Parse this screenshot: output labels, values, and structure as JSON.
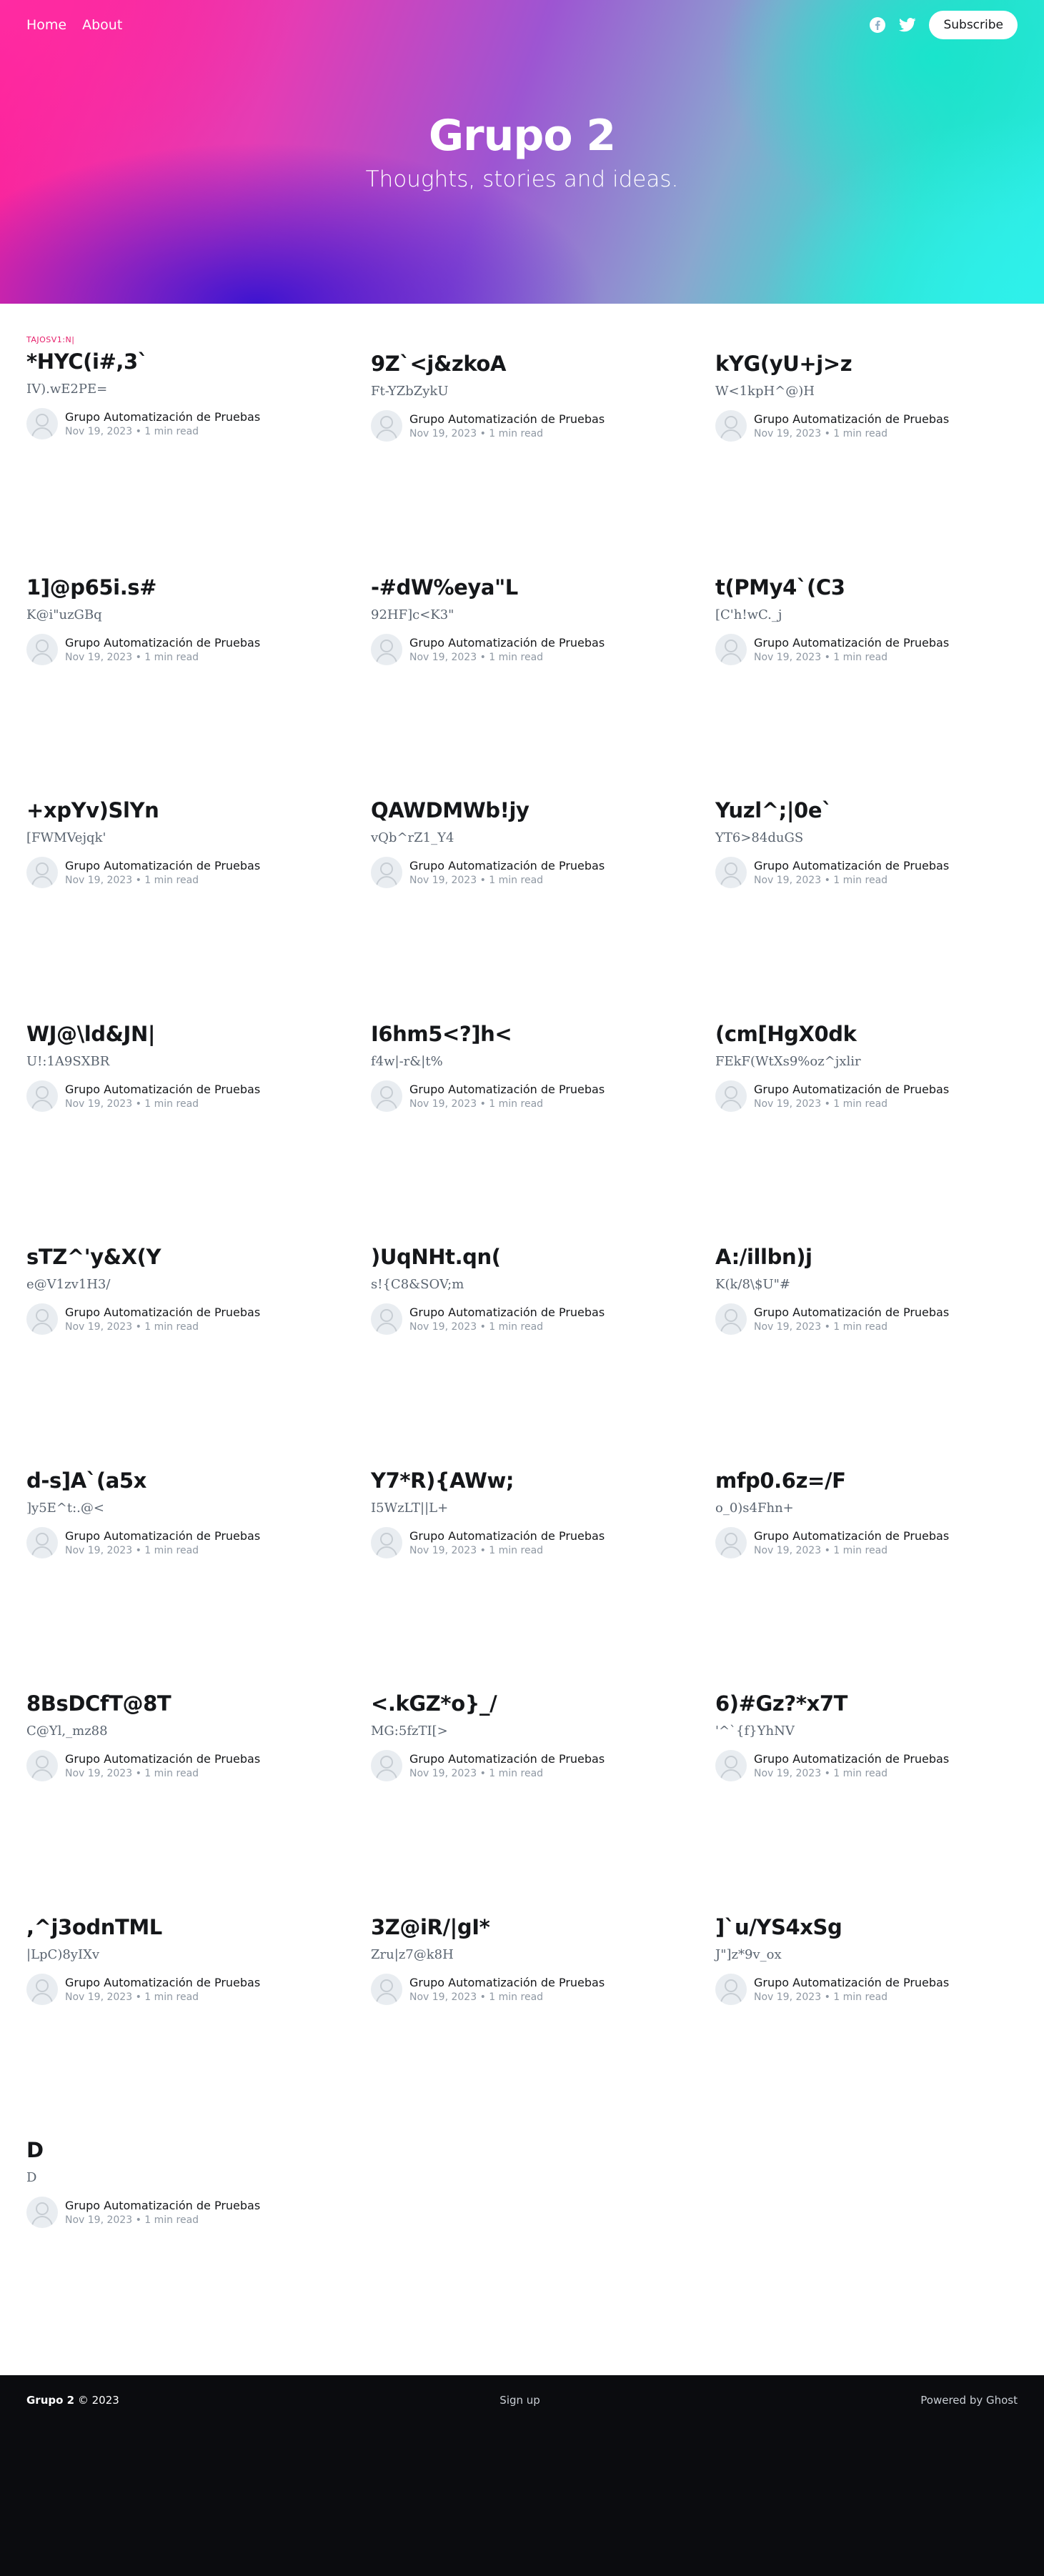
{
  "nav": {
    "home": "Home",
    "about": "About",
    "subscribe": "Subscribe"
  },
  "hero": {
    "title": "Grupo 2",
    "description": "Thoughts, stories and ideas."
  },
  "posts": [
    {
      "tag": "TAJOSV1:N|",
      "title": "*HYC(i#,3`",
      "excerpt": "IV).wE2PE=",
      "author": "Grupo Automatización de Pruebas",
      "date": "Nov 19, 2023",
      "read": "1 min read"
    },
    {
      "tag": "",
      "title": "9Z`<j&zkoA",
      "excerpt": "Ft-YZbZykU",
      "author": "Grupo Automatización de Pruebas",
      "date": "Nov 19, 2023",
      "read": "1 min read"
    },
    {
      "tag": "",
      "title": "kYG(yU+j>z",
      "excerpt": "W<1kpH^@)H",
      "author": "Grupo Automatización de Pruebas",
      "date": "Nov 19, 2023",
      "read": "1 min read"
    },
    {
      "tag": "",
      "title": "1]@p65i.s#",
      "excerpt": "K@i\"uzGBq",
      "author": "Grupo Automatización de Pruebas",
      "date": "Nov 19, 2023",
      "read": "1 min read"
    },
    {
      "tag": "",
      "title": "-#dW%eya\"L",
      "excerpt": "92HF]c<K3\"",
      "author": "Grupo Automatización de Pruebas",
      "date": "Nov 19, 2023",
      "read": "1 min read"
    },
    {
      "tag": "",
      "title": "t(PMy4`(C3",
      "excerpt": "[C'h!wC._j",
      "author": "Grupo Automatización de Pruebas",
      "date": "Nov 19, 2023",
      "read": "1 min read"
    },
    {
      "tag": "",
      "title": "+xpYv)SlYn",
      "excerpt": "[FWMVejqk'",
      "author": "Grupo Automatización de Pruebas",
      "date": "Nov 19, 2023",
      "read": "1 min read"
    },
    {
      "tag": "",
      "title": "QAWDMWb!jy",
      "excerpt": "vQb^rZ1_Y4",
      "author": "Grupo Automatización de Pruebas",
      "date": "Nov 19, 2023",
      "read": "1 min read"
    },
    {
      "tag": "",
      "title": "Yuzl^;|0e`",
      "excerpt": "YT6>84duGS",
      "author": "Grupo Automatización de Pruebas",
      "date": "Nov 19, 2023",
      "read": "1 min read"
    },
    {
      "tag": "",
      "title": "WJ@\\ld&JN|",
      "excerpt": "U!:1A9SXBR",
      "author": "Grupo Automatización de Pruebas",
      "date": "Nov 19, 2023",
      "read": "1 min read"
    },
    {
      "tag": "",
      "title": "I6hm5<?]h<",
      "excerpt": "f4w|-r&|t%",
      "author": "Grupo Automatización de Pruebas",
      "date": "Nov 19, 2023",
      "read": "1 min read"
    },
    {
      "tag": "",
      "title": "(cm[HgX0dk",
      "excerpt": "FEkF(WtXs9%oz^jxlir",
      "author": "Grupo Automatización de Pruebas",
      "date": "Nov 19, 2023",
      "read": "1 min read"
    },
    {
      "tag": "",
      "title": "sTZ^'y&X(Y",
      "excerpt": "e@V1zv1H3/",
      "author": "Grupo Automatización de Pruebas",
      "date": "Nov 19, 2023",
      "read": "1 min read"
    },
    {
      "tag": "",
      "title": ")UqNHt.qn(",
      "excerpt": "s!{C8&SOV;m",
      "author": "Grupo Automatización de Pruebas",
      "date": "Nov 19, 2023",
      "read": "1 min read"
    },
    {
      "tag": "",
      "title": "A:/illbn)j",
      "excerpt": "K(k/8\\$U\"#",
      "author": "Grupo Automatización de Pruebas",
      "date": "Nov 19, 2023",
      "read": "1 min read"
    },
    {
      "tag": "",
      "title": "d-s]A`(a5x",
      "excerpt": "]y5E^t:.@<",
      "author": "Grupo Automatización de Pruebas",
      "date": "Nov 19, 2023",
      "read": "1 min read"
    },
    {
      "tag": "",
      "title": "Y7*R){AWw;",
      "excerpt": "I5WzLT||L+",
      "author": "Grupo Automatización de Pruebas",
      "date": "Nov 19, 2023",
      "read": "1 min read"
    },
    {
      "tag": "",
      "title": "mfp0.6z=/F",
      "excerpt": "o_0)s4Fhn+",
      "author": "Grupo Automatización de Pruebas",
      "date": "Nov 19, 2023",
      "read": "1 min read"
    },
    {
      "tag": "",
      "title": "8BsDCfT@8T",
      "excerpt": "C@Yl,_mz88",
      "author": "Grupo Automatización de Pruebas",
      "date": "Nov 19, 2023",
      "read": "1 min read"
    },
    {
      "tag": "",
      "title": "<.kGZ*o}_/",
      "excerpt": "MG:5fzTI[>",
      "author": "Grupo Automatización de Pruebas",
      "date": "Nov 19, 2023",
      "read": "1 min read"
    },
    {
      "tag": "",
      "title": "6)#Gz?*x7T",
      "excerpt": "'^`{f}YhNV",
      "author": "Grupo Automatización de Pruebas",
      "date": "Nov 19, 2023",
      "read": "1 min read"
    },
    {
      "tag": "",
      "title": ",^j3odnTML",
      "excerpt": "|LpC)8yIXv",
      "author": "Grupo Automatización de Pruebas",
      "date": "Nov 19, 2023",
      "read": "1 min read"
    },
    {
      "tag": "",
      "title": "3Z@iR/|gI*",
      "excerpt": "Zru|z7@k8H",
      "author": "Grupo Automatización de Pruebas",
      "date": "Nov 19, 2023",
      "read": "1 min read"
    },
    {
      "tag": "",
      "title": "]`u/YS4xSg",
      "excerpt": "J\"]z*9v_ox",
      "author": "Grupo Automatización de Pruebas",
      "date": "Nov 19, 2023",
      "read": "1 min read"
    },
    {
      "tag": "",
      "title": "D",
      "excerpt": "D",
      "author": "Grupo Automatización de Pruebas",
      "date": "Nov 19, 2023",
      "read": "1 min read"
    }
  ],
  "footer": {
    "site": "Grupo 2",
    "copyright": "© 2023",
    "signup": "Sign up",
    "powered": "Powered by Ghost"
  },
  "icons": {
    "facebook": "facebook-icon",
    "twitter": "twitter-icon",
    "avatar": "avatar-icon"
  },
  "colors": {
    "tag": "#e61e6a",
    "footer_bg": "#0b0c0f"
  }
}
